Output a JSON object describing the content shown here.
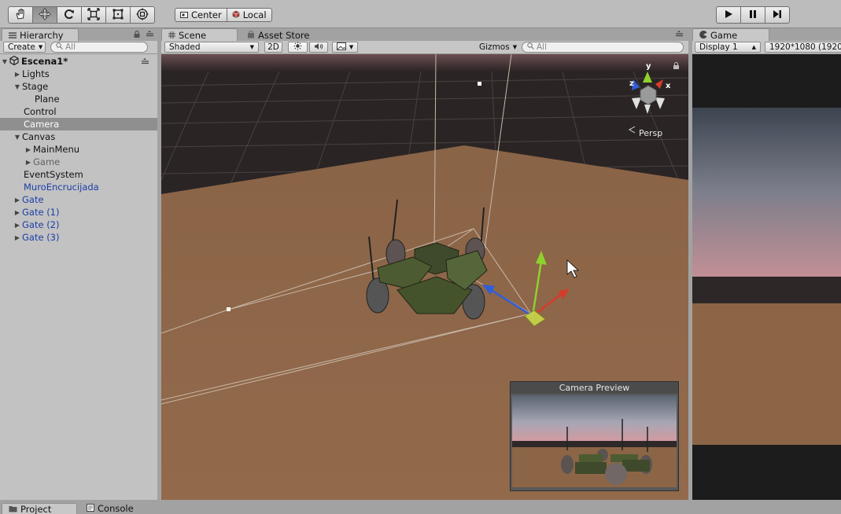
{
  "toolbar": {
    "tools": [
      {
        "icon": "hand-icon"
      },
      {
        "icon": "move-icon"
      },
      {
        "icon": "rotate-icon"
      },
      {
        "icon": "scale-icon"
      },
      {
        "icon": "rect-icon"
      },
      {
        "icon": "transform-icon"
      }
    ],
    "pivot_label": "Center",
    "space_label": "Local"
  },
  "tabs": {
    "hierarchy": "Hierarchy",
    "scene": "Scene",
    "asset_store": "Asset Store",
    "game": "Game"
  },
  "hierarchy": {
    "create_label": "Create",
    "search_placeholder": "All",
    "scene_name": "Escena1*",
    "items": [
      {
        "label": "Lights"
      },
      {
        "label": "Stage"
      },
      {
        "label": "Plane"
      },
      {
        "label": "Control"
      },
      {
        "label": "Camera"
      },
      {
        "label": "Canvas"
      },
      {
        "label": "MainMenu"
      },
      {
        "label": "Game"
      },
      {
        "label": "EventSystem"
      },
      {
        "label": "MuroEncrucijada"
      },
      {
        "label": "Gate"
      },
      {
        "label": "Gate (1)"
      },
      {
        "label": "Gate (2)"
      },
      {
        "label": "Gate (3)"
      }
    ]
  },
  "scene": {
    "shading_mode": "Shaded",
    "mode_2d": "2D",
    "gizmos_label": "Gizmos",
    "search_placeholder": "All",
    "axis_x": "x",
    "axis_y": "y",
    "axis_z": "z",
    "projection_label": "Persp",
    "camera_preview_title": "Camera Preview"
  },
  "game": {
    "display_label": "Display 1",
    "resolution_label": "1920*1080 (1920"
  },
  "bottom_tabs": {
    "project": "Project",
    "console": "Console"
  },
  "colors": {
    "selection": "#8f8f8f",
    "prefab_text": "#1c3ea8",
    "axis_x": "#d93a2b",
    "axis_y": "#8ed12c",
    "axis_z": "#2f5ed9"
  }
}
